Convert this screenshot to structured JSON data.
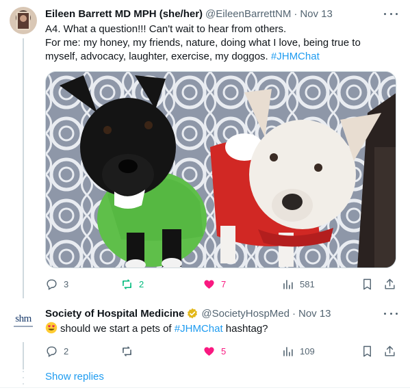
{
  "tweets": [
    {
      "author_name": "Eileen Barrett MD MPH (she/her)",
      "handle": "@EileenBarrettNM",
      "separator": "·",
      "date": "Nov 13",
      "text_line1": "A4. What a question!!! Can't wait to hear from others.",
      "text_line2": "For me: my honey, my friends, nature, doing what I love, being true to",
      "text_line3": "myself, advocacy, laughter, exercise, my doggos. ",
      "hashtag": "#JHMChat",
      "media": "photo-two-dogs",
      "replies": "3",
      "retweets": "2",
      "likes": "7",
      "views": "581",
      "retweet_state": "active",
      "like_state": "active"
    },
    {
      "author_name": "Society of Hospital Medicine",
      "handle": "@SocietyHospMed",
      "separator": "·",
      "date": "Nov 13",
      "avatar_text": "shm",
      "emoji": "smiling-face-with-heart-eyes",
      "text_before": "should we start a pets of ",
      "hashtag": "#JHMChat",
      "text_after": " hashtag?",
      "verified": true,
      "replies": "2",
      "retweets": "",
      "likes": "5",
      "views": "109",
      "like_state": "active"
    }
  ],
  "show_replies_label": "Show replies",
  "colors": {
    "link": "#1d9bf0",
    "secondary_text": "#536471",
    "retweet": "#00ba7c",
    "like": "#f91880",
    "verified_gold": "#e2b719"
  }
}
